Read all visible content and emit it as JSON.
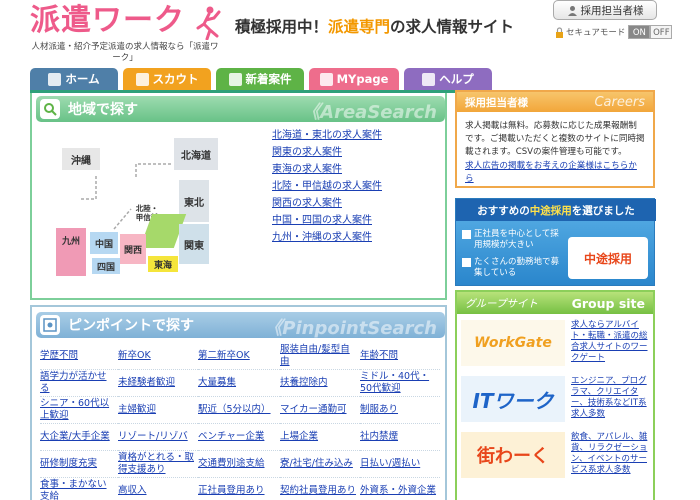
{
  "header": {
    "logo_text": "派遣ワーク",
    "logo_subtitle": "人材派遣・紹介予定派遣の求人情報なら「派遣ワーク」",
    "tagline_pre": "積極採用中！",
    "tagline_hl": "派遣専門",
    "tagline_post": "の求人情報サイト",
    "login_label": "採用担当者様",
    "secure_label": "セキュアモード",
    "toggle_on": "ON",
    "toggle_off": "OFF"
  },
  "nav": [
    {
      "label": "ホーム",
      "color": "#4f7fa8"
    },
    {
      "label": "スカウト",
      "color": "#f2a21f"
    },
    {
      "label": "新着案件",
      "color": "#5eb346"
    },
    {
      "label": "MYpage",
      "color": "#ee6d8c"
    },
    {
      "label": "ヘルプ",
      "color": "#8e6cc0"
    }
  ],
  "area": {
    "title": "地域で探す",
    "title_en": "《AreaSearch",
    "map_regions": {
      "okinawa": "沖縄",
      "hokkaido": "北海道",
      "tohoku": "東北",
      "hokuriku": "北陸・甲信越",
      "kyushu": "九州",
      "chugoku": "中国",
      "shikoku": "四国",
      "kansai": "関西",
      "tokai": "東海",
      "kanto": "関東"
    },
    "links": [
      "北海道・東北の求人案件",
      "関東の求人案件",
      "東海の求人案件",
      "北陸・甲信越の求人案件",
      "関西の求人案件",
      "中国・四国の求人案件",
      "九州・沖縄の求人案件"
    ]
  },
  "pinpoint": {
    "title": "ピンポイントで探す",
    "title_en": "《PinpointSearch",
    "items": [
      "学歴不問",
      "新卒OK",
      "第二新卒OK",
      "服装自由/髪型自由",
      "年齢不問",
      "語学力が活かせる",
      "未経験者歓迎",
      "大量募集",
      "扶養控除内",
      "ミドル・40代・50代歓迎",
      "シニア・60代以上歓迎",
      "主婦歓迎",
      "駅近（5分以内）",
      "マイカー通勤可",
      "制服あり",
      "大企業/大手企業",
      "リゾート/リゾバ",
      "ベンチャー企業",
      "上場企業",
      "社内禁煙",
      "研修制度充実",
      "資格がとれる・取得支援あり",
      "交通費別途支給",
      "寮/社宅/住み込み",
      "日払い/週払い",
      "食事・まかない支給",
      "高収入",
      "正社員登用あり",
      "契約社員登用あり",
      "外資系・外資企業"
    ]
  },
  "careers": {
    "title_jp": "採用担当者様",
    "title_en": "Careers",
    "body": "求人掲載は無料。応募数に応じた成果報酬制です。ご掲載いただくと複数のサイトに同時掲載されます。CSVの案件管理も可能です。",
    "link": "求人広告の掲載をお考えの企業様はこちらから"
  },
  "banner": {
    "title_pre": "おすすめの",
    "title_hl": "中途採用",
    "title_post": "を選びました",
    "point1": "正社員を中心として採用規模が大きい",
    "point2": "たくさんの勤務地で募集している",
    "brand": "中途採用"
  },
  "group": {
    "title_jp": "グループサイト",
    "title_en": "Group site",
    "sites": [
      {
        "logo": "WorkGate",
        "desc": "求人ならアルバイト・転職・派遣の総合求人サイトのワークゲート",
        "color": "#f0a020"
      },
      {
        "logo": "ITワーク",
        "desc": "エンジニア、プログラマ、クリエイター、技術系などIT系求人多数",
        "color": "#1e64c8"
      },
      {
        "logo": "街わーく",
        "desc": "飲食、アパレル、雑貨、リラクゼーション、イベントのサービス系求人多数",
        "color": "#e8461a"
      }
    ]
  }
}
